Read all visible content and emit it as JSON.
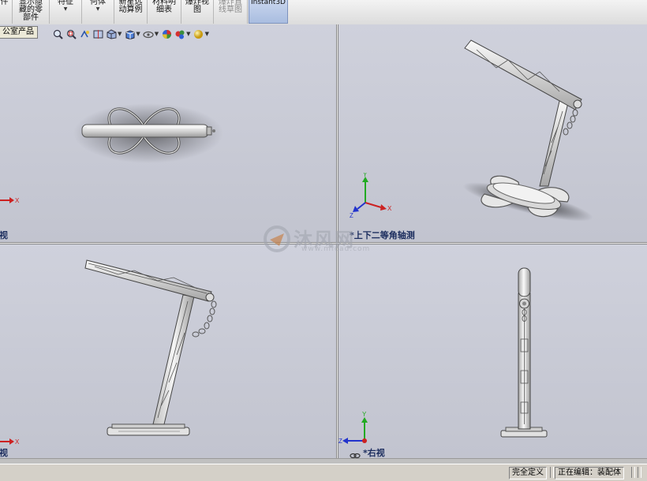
{
  "toolbar": {
    "items": [
      {
        "label": "件",
        "arrow": false,
        "state": "normal"
      },
      {
        "label": "显示隐\n藏的零\n部件",
        "arrow": false,
        "state": "normal"
      },
      {
        "label": "特征",
        "arrow": true,
        "state": "normal"
      },
      {
        "label": "何体",
        "arrow": true,
        "state": "normal"
      },
      {
        "label": "新星远\n动算例",
        "arrow": false,
        "state": "normal"
      },
      {
        "label": "材料明\n细表",
        "arrow": false,
        "state": "normal"
      },
      {
        "label": "爆炸视\n图",
        "arrow": false,
        "state": "normal"
      },
      {
        "label": "爆炸直\n线草图",
        "arrow": false,
        "state": "disabled"
      },
      {
        "label": "Instant3D",
        "arrow": false,
        "state": "active"
      }
    ]
  },
  "feature_tree_tab": {
    "label": "公室产品"
  },
  "view_tools": [
    "zoom-to-fit-icon",
    "zoom-to-area-icon",
    "previous-view-icon",
    "section-view-icon",
    "view-orientation-icon",
    "display-style-icon",
    "hide-show-icon",
    "edit-appearance-icon",
    "apply-scene-icon",
    "view-settings-icon"
  ],
  "viewports": {
    "top_left": {
      "label": "视"
    },
    "top_right": {
      "label": "*上下二等角轴测"
    },
    "bottom_left": {
      "label": "视"
    },
    "bottom_right": {
      "label": "*右视"
    }
  },
  "triad_axes": {
    "x": "X",
    "y": "Y",
    "z": "Z"
  },
  "watermark": {
    "text": "沐风网",
    "url": "www.mfcad.com"
  },
  "status": {
    "definition": "完全定义",
    "editing": "正在编辑：装配体"
  },
  "colors": {
    "viewport_bg": "#c9cbd6",
    "label": "#1c2d5e",
    "axis_x": "#cc2222",
    "axis_y": "#22aa22",
    "axis_z": "#2233cc",
    "model_metal": "#e4e4e4"
  }
}
